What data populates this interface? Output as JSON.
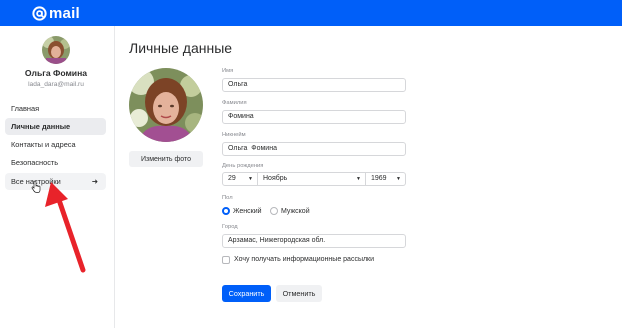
{
  "header": {
    "logo_text": "mail",
    "brand_color": "#005ff9"
  },
  "profile": {
    "name": "Ольга Фомина",
    "email": "lada_dara@mail.ru"
  },
  "sidebar": {
    "items": [
      {
        "label": "Главная",
        "active": false
      },
      {
        "label": "Личные данные",
        "active": true
      },
      {
        "label": "Контакты и адреса",
        "active": false
      },
      {
        "label": "Безопасность",
        "active": false
      },
      {
        "label": "Все настройки",
        "active": false,
        "arrow": "➜"
      }
    ]
  },
  "main": {
    "title": "Личные данные",
    "change_photo_label": "Изменить фото",
    "first_name": {
      "label": "Имя",
      "value": "Ольга"
    },
    "last_name": {
      "label": "Фамилия",
      "value": "Фомина"
    },
    "nickname": {
      "label": "Никнейм",
      "value": "Ольга  Фомина"
    },
    "birthday": {
      "label": "День рождения",
      "day": "29",
      "month": "Ноябрь",
      "year": "1969"
    },
    "gender": {
      "label": "Пол",
      "options": [
        "Женский",
        "Мужской"
      ],
      "selected": "Женский"
    },
    "city": {
      "label": "Город",
      "value": "Арзамас, Нижегородская обл."
    },
    "newsletter": {
      "label": "Хочу получать информационные рассылки",
      "checked": false
    },
    "save_label": "Сохранить",
    "cancel_label": "Отменить"
  },
  "annotation": {
    "arrow_color": "#e8232a",
    "icon": "red-arrow-icon"
  }
}
